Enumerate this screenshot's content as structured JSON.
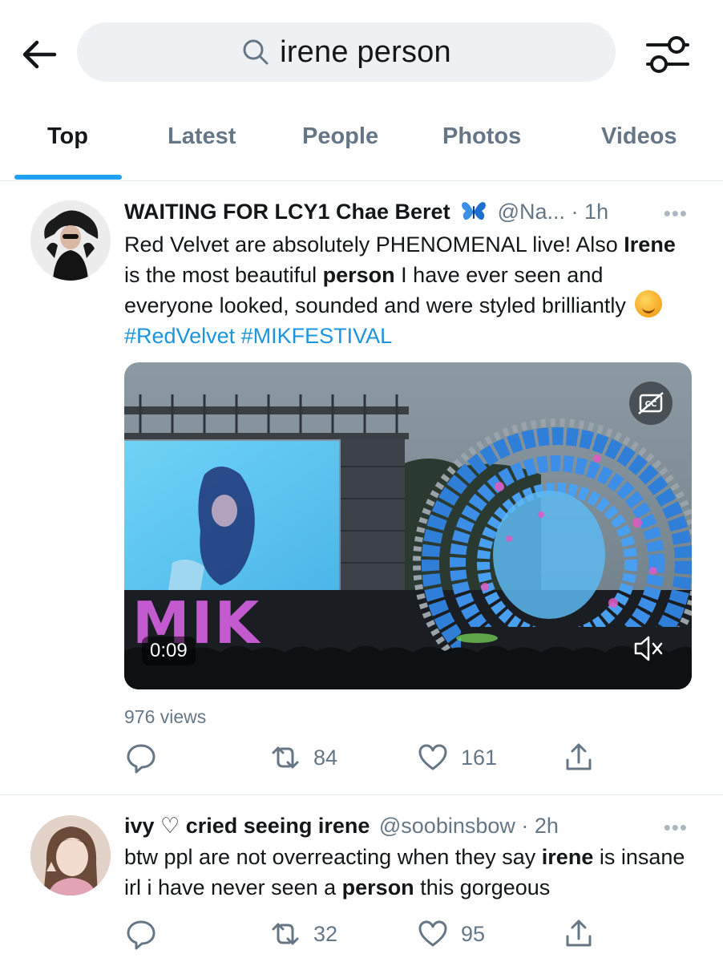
{
  "header": {
    "search_query": "irene person"
  },
  "tabs": [
    {
      "label": "Top",
      "active": true
    },
    {
      "label": "Latest",
      "active": false
    },
    {
      "label": "People",
      "active": false
    },
    {
      "label": "Photos",
      "active": false
    },
    {
      "label": "Videos",
      "active": false
    }
  ],
  "tweets": [
    {
      "name": "WAITING FOR LCY1 Chae Beret",
      "name_emoji": "butterfly-icon",
      "handle": "@Na...",
      "separator": "·",
      "time": "1h",
      "body": {
        "line1": "Red Velvet are absolutely PHENOMENAL live! Also",
        "kw1": "Irene",
        "mid1": " is the most beautiful ",
        "kw2": "person",
        "mid2": " I have ever seen and everyone looked, sounded and were styled brilliantly",
        "hashtag1": "#RedVelvet",
        "hashtag2": "#MIKFESTIVAL"
      },
      "video": {
        "duration": "0:09",
        "screen_text": "MIK"
      },
      "views": "976 views",
      "retweets": "84",
      "likes": "161"
    },
    {
      "name": "ivy ♡ cried seeing irene",
      "handle": "@soobinsbow",
      "separator": "·",
      "time": "2h",
      "body": {
        "pre1": "btw ppl are not overreacting when they say ",
        "kw1": "irene",
        "mid1": " is insane irl i have never seen a ",
        "kw2": "person",
        "post": " this gorgeous"
      },
      "retweets": "32",
      "likes": "95"
    }
  ],
  "colors": {
    "accent": "#1da1f2",
    "link": "#1b95e0",
    "muted": "#657786",
    "search_bg": "#eef1f3"
  }
}
